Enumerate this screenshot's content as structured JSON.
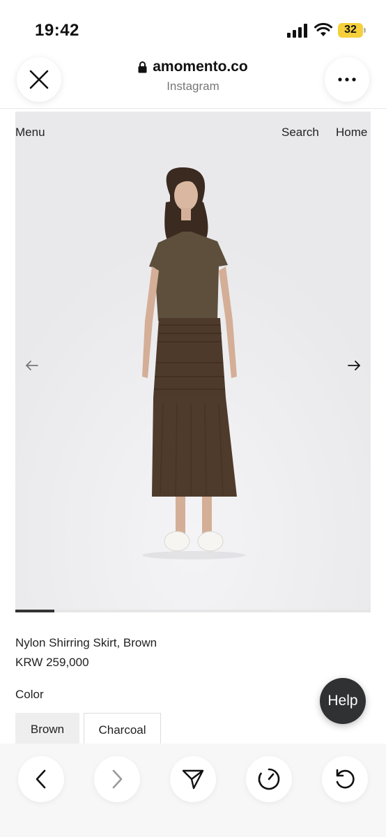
{
  "status_bar": {
    "time": "19:42",
    "battery": "32",
    "icons": [
      "signal-icon",
      "wifi-icon",
      "battery-icon"
    ]
  },
  "browser": {
    "domain": "amomento.co",
    "source": "Instagram",
    "icons": [
      "close-icon",
      "lock-icon",
      "more-icon"
    ]
  },
  "site_nav": {
    "menu": "Menu",
    "search": "Search",
    "home": "Home"
  },
  "gallery": {
    "progress_fraction": 0.11,
    "icons": [
      "arrow-left-icon",
      "arrow-right-icon"
    ]
  },
  "product": {
    "name": "Nylon Shirring Skirt, Brown",
    "price": "KRW 259,000",
    "color_label": "Color",
    "colors": [
      "Brown",
      "Charcoal"
    ],
    "selected_color": "Brown"
  },
  "help": {
    "label": "Help"
  },
  "toolbar": {
    "icons": [
      "back-icon",
      "forward-icon",
      "share-icon",
      "speed-icon",
      "reload-icon"
    ]
  },
  "colors": {
    "battery": "#f5d03b",
    "gallery_bg": "#ececee",
    "help_bg": "#2f3133",
    "skirt": "#4e3a2b"
  }
}
